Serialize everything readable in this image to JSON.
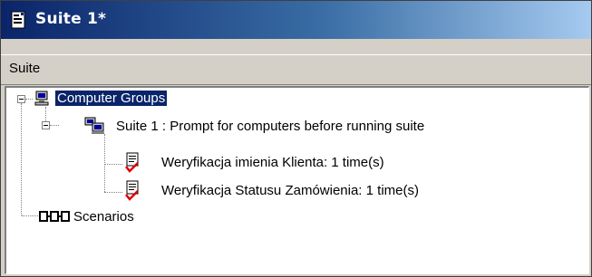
{
  "window": {
    "title": "Suite 1*"
  },
  "menu": {
    "label": "Suite"
  },
  "tree": {
    "root": {
      "label": "Computer Groups"
    },
    "group": {
      "label": "Suite 1 : Prompt for computers before running suite"
    },
    "tests": [
      {
        "label": "Weryfikacja imienia Klienta: 1 time(s)"
      },
      {
        "label": "Weryfikacja Statusu Zamówienia: 1 time(s)"
      }
    ],
    "scenarios": {
      "label": "Scenarios"
    }
  }
}
